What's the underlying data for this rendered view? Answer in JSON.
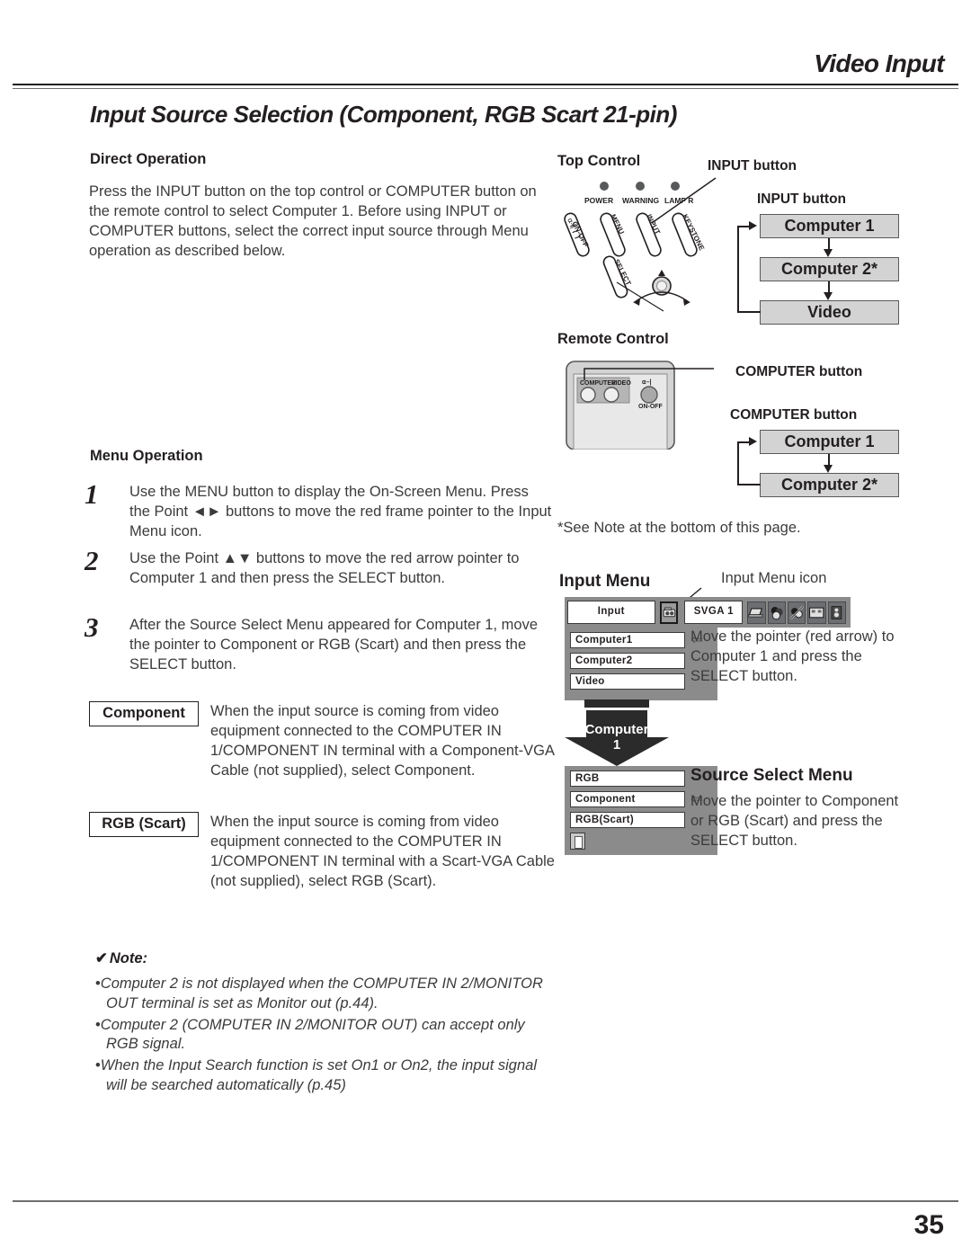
{
  "header": {
    "section_title": "Video Input",
    "page_heading": "Input Source Selection (Component, RGB Scart 21-pin)"
  },
  "left": {
    "direct_operation": {
      "heading": "Direct Operation",
      "body": "Press the INPUT button on the top control or COMPUTER button on the remote control to select Computer 1. Before using INPUT or COMPUTER buttons, select the correct input source through Menu operation as described below."
    },
    "menu_operation": {
      "heading": "Menu Operation",
      "steps": [
        {
          "num": "1",
          "text": "Use the MENU button to display the On-Screen Menu. Press the Point ◄► buttons to move the red frame pointer to the Input Menu icon."
        },
        {
          "num": "2",
          "text": "Use the Point ▲▼ buttons to move the red arrow pointer to Computer 1 and then press the SELECT button."
        },
        {
          "num": "3",
          "text": "After the Source Select Menu appeared for Computer 1, move the pointer to Component or RGB (Scart) and then press the SELECT button."
        }
      ]
    },
    "terms": [
      {
        "label": "Component",
        "text": "When the input source is coming from video equipment connected to the COMPUTER IN 1/COMPONENT IN terminal with a Component-VGA Cable (not supplied), select Component."
      },
      {
        "label": "RGB (Scart)",
        "text": "When the input source is coming from video equipment connected to the COMPUTER IN 1/COMPONENT IN terminal with a Scart-VGA Cable (not supplied), select RGB (Scart)."
      }
    ],
    "note": {
      "check": "✔",
      "heading": "Note:",
      "bullet": "•",
      "items": [
        "Computer 2 is not displayed when the COMPUTER IN 2/MONITOR OUT terminal is set as Monitor out (p.44).",
        "Computer 2 (COMPUTER IN 2/MONITOR OUT) can accept only RGB signal.",
        "When the Input Search function is set On1 or On2, the input signal will be searched automatically (p.45)"
      ]
    }
  },
  "right": {
    "top_control": {
      "heading": "Top Control",
      "callout_illustration": "INPUT button",
      "callout_flow": "INPUT button",
      "indicators": [
        "POWER",
        "WARNING",
        "LAMP R"
      ],
      "buttons": [
        "ON-OFF",
        "MENU",
        "INPUT",
        "KEYSTONE",
        "SELECT"
      ],
      "flow": [
        "Computer 1",
        "Computer 2*",
        "Video"
      ]
    },
    "remote_control": {
      "heading": "Remote Control",
      "callout_illustration": "COMPUTER button",
      "callout_flow": "COMPUTER button",
      "buttons": [
        "COMPUTER",
        "VIDEO",
        "ON-OFF"
      ],
      "flow": [
        "Computer 1",
        "Computer 2*"
      ]
    },
    "see_note": "*See Note at the bottom of this page.",
    "input_menu": {
      "heading": "Input Menu",
      "icon_callout": "Input Menu icon",
      "bar_label": "Input",
      "bar_value": "SVGA 1",
      "icons": [
        "input-menu-icon",
        "computer-icon",
        "color-adjust-icon",
        "image-select-icon",
        "screen-icon",
        "sound-icon"
      ],
      "items": [
        "Computer1",
        "Computer2",
        "Video"
      ],
      "pointer": "⇐",
      "description": "Move the pointer (red arrow) to Computer 1 and press the SELECT button."
    },
    "transition_arrow": {
      "line1": "Computer",
      "line2": "1"
    },
    "source_select_menu": {
      "heading": "Source Select Menu",
      "items": [
        "RGB",
        "Component",
        "RGB(Scart)"
      ],
      "pointer": "⇐",
      "description": "Move the pointer to Component or RGB (Scart) and press the SELECT button."
    }
  },
  "footer": {
    "page_number": "35"
  }
}
